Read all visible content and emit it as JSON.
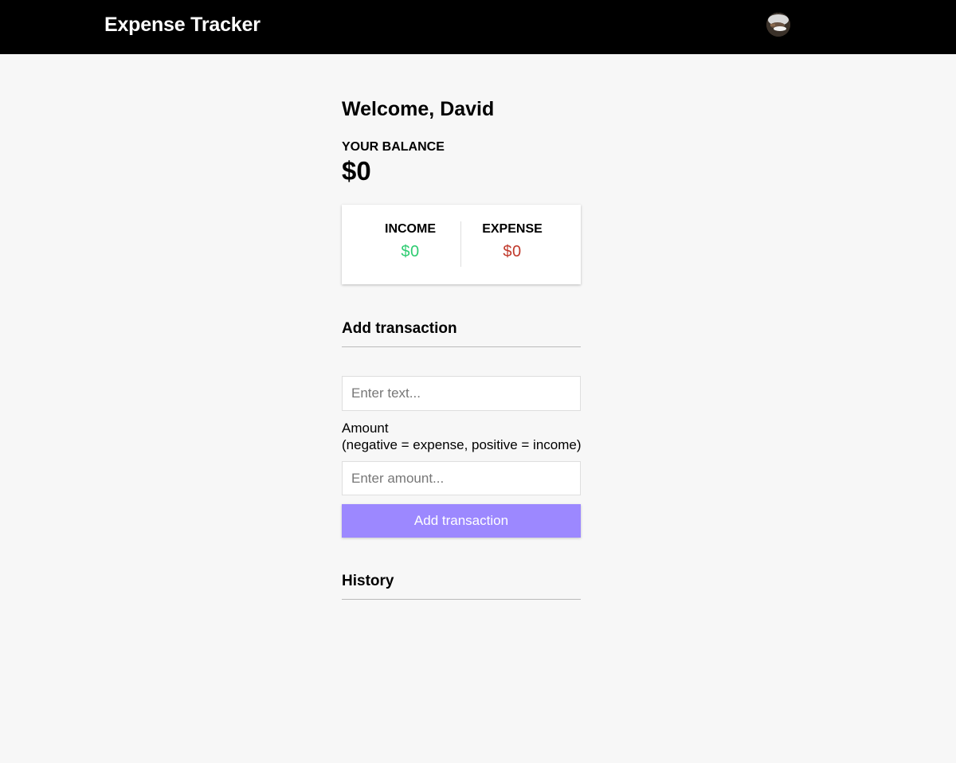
{
  "header": {
    "title": "Expense Tracker",
    "avatar_icon": "user-avatar-icon"
  },
  "main": {
    "welcome": "Welcome, David",
    "balance": {
      "label": "YOUR BALANCE",
      "value": "$0"
    },
    "summary": {
      "income_label": "INCOME",
      "income_value": "$0",
      "income_color": "#2ecc71",
      "expense_label": "EXPENSE",
      "expense_value": "$0",
      "expense_color": "#c0392b"
    },
    "add_transaction": {
      "title": "Add transaction",
      "text_placeholder": "Enter text...",
      "text_value": "",
      "amount_label_line1": "Amount",
      "amount_label_line2": "(negative = expense, positive = income)",
      "amount_placeholder": "Enter amount...",
      "amount_value": "",
      "button_label": "Add transaction",
      "button_color": "#9c88ff"
    },
    "history": {
      "title": "History",
      "items": []
    }
  }
}
